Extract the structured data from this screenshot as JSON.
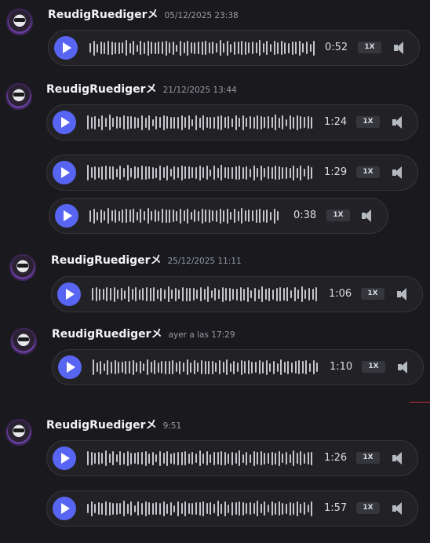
{
  "messages": [
    {
      "username": "ReudigRuedigerメ",
      "timestamp": "05/12/2025 23:38",
      "audios": [
        {
          "duration": "0:52",
          "speed": "1X"
        }
      ]
    },
    {
      "username": "ReudigRuedigerメ",
      "timestamp": "21/12/2025 13:44",
      "audios": [
        {
          "duration": "1:24",
          "speed": "1X"
        },
        {
          "duration": "1:29",
          "speed": "1X"
        },
        {
          "duration": "0:38",
          "speed": "1X"
        }
      ]
    },
    {
      "username": "ReudigRuedigerメ",
      "timestamp": "25/12/2025 11:11",
      "audios": [
        {
          "duration": "1:06",
          "speed": "1X"
        }
      ]
    },
    {
      "username": "ReudigRuedigerメ",
      "timestamp": "ayer a las 17:29",
      "audios": [
        {
          "duration": "1:10",
          "speed": "1X"
        }
      ]
    },
    {
      "username": "ReudigRuedigerメ",
      "timestamp": "9:51",
      "audios": [
        {
          "duration": "1:26",
          "speed": "1X"
        },
        {
          "duration": "1:57",
          "speed": "1X"
        }
      ]
    }
  ],
  "icons": {
    "play": "play-icon",
    "volume": "volume-icon"
  },
  "colors": {
    "background": "#1a1a1e",
    "play_button": "#5865f2",
    "timestamp": "#949ba4"
  }
}
